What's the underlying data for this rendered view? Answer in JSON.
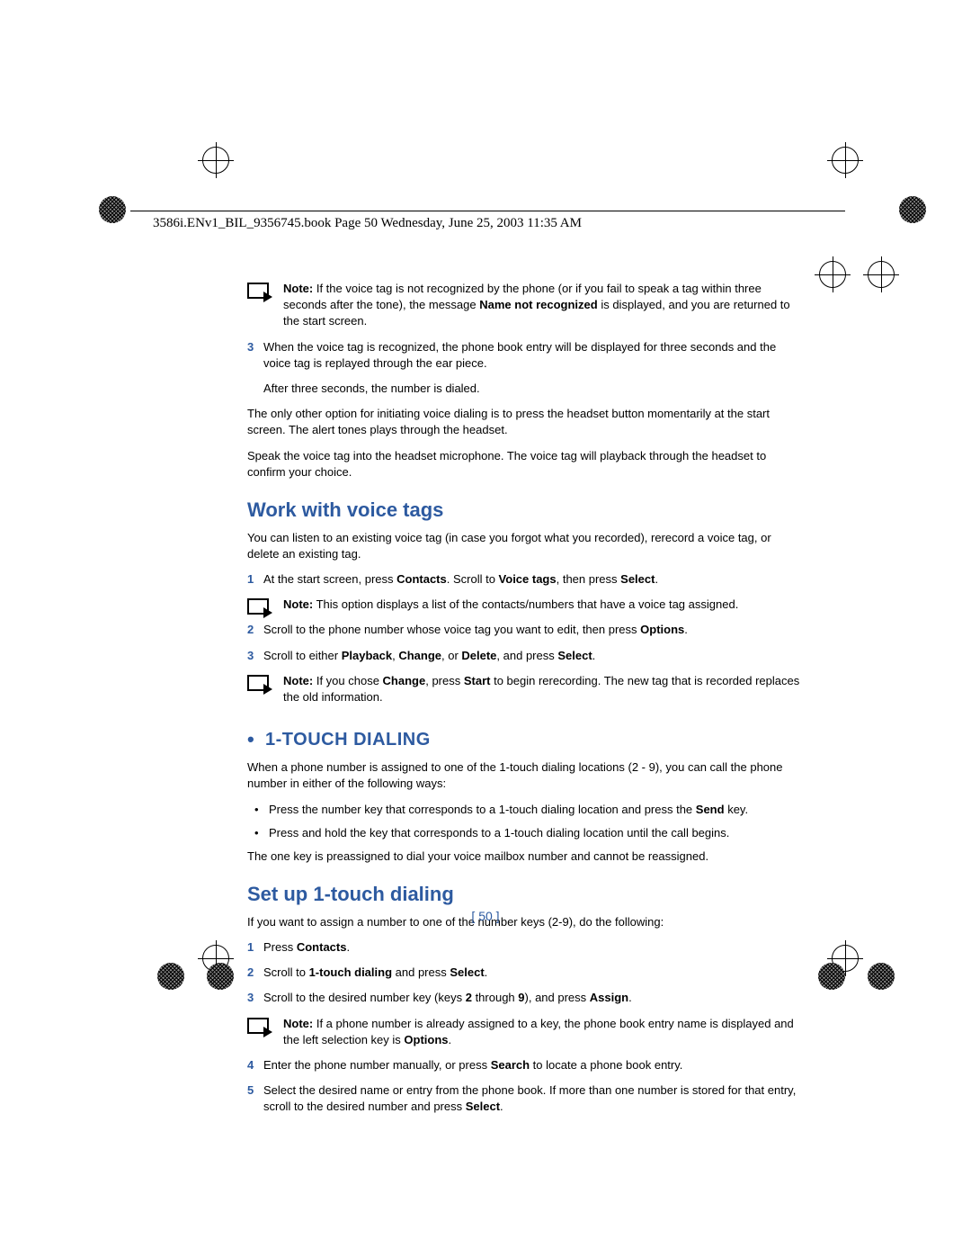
{
  "header": "3586i.ENv1_BIL_9356745.book  Page 50  Wednesday, June 25, 2003  11:35 AM",
  "note1_lead": "Note:",
  "note1_a": " If the voice tag is not recognized by the phone (or if you fail to speak a tag within three seconds after the tone), the message ",
  "note1_b": "Name not recognized",
  "note1_c": " is displayed, and you are returned to the start screen.",
  "step3_top": "When the voice tag is recognized, the phone book entry will be displayed for three seconds and the voice tag is replayed through the ear piece.",
  "step3_after": "After three seconds, the number is dialed.",
  "para_headset1": "The only other option for initiating voice dialing is to press the headset button momentarily at the start screen. The alert tones plays through the headset.",
  "para_headset2": "Speak the voice tag into the headset microphone. The voice tag will playback through the headset to confirm your choice.",
  "h_work": "Work with voice tags",
  "work_intro": "You can listen to an existing voice tag (in case you forgot what you recorded), rerecord a voice tag, or delete an existing tag.",
  "w1_a": "At the start screen, press ",
  "w1_contacts": "Contacts",
  "w1_b": ". Scroll to ",
  "w1_voice": "Voice tags",
  "w1_c": ", then press ",
  "w1_select": "Select",
  "w1_d": ".",
  "note2_lead": "Note:",
  "note2_body": " This option displays a list of the contacts/numbers that have a voice tag assigned.",
  "w2_a": "Scroll to the phone number whose voice tag you want to edit, then press ",
  "w2_opt": "Options",
  "w2_b": ".",
  "w3_a": "Scroll to either ",
  "w3_pb": "Playback",
  "w3_c1": ", ",
  "w3_ch": "Change",
  "w3_c2": ", or ",
  "w3_del": "Delete",
  "w3_c3": ", and press ",
  "w3_sel": "Select",
  "w3_c4": ".",
  "note3_lead": "Note:",
  "note3_a": " If you chose ",
  "note3_ch": "Change",
  "note3_b": ", press ",
  "note3_start": "Start",
  "note3_c": " to begin rerecording. The new tag that is recorded replaces the old information.",
  "h_touch": "1-TOUCH DIALING",
  "touch_intro": "When a phone number is assigned to one of the 1-touch dialing locations (2 - 9), you can call the phone number in either of the following ways:",
  "tb1_a": "Press the number key that corresponds to a 1-touch dialing location and press the ",
  "tb1_send": "Send",
  "tb1_b": " key.",
  "tb2": "Press and hold the key that corresponds to a 1-touch dialing location until the call begins.",
  "touch_one": "The one key is preassigned to dial your voice mailbox number and cannot be reassigned.",
  "h_setup": "Set up 1-touch dialing",
  "setup_intro": "If you want to assign a number to one of the number keys (2-9), do the following:",
  "s1_a": "Press ",
  "s1_contacts": "Contacts",
  "s1_b": ".",
  "s2_a": "Scroll to ",
  "s2_1t": "1-touch dialing",
  "s2_b": " and press ",
  "s2_sel": "Select",
  "s2_c": ".",
  "s3_a": "Scroll to the desired number key (keys ",
  "s3_2": "2",
  "s3_b": " through ",
  "s3_9": "9",
  "s3_c": "), and press ",
  "s3_asg": "Assign",
  "s3_d": ".",
  "note4_lead": "Note:",
  "note4_a": " If a phone number is already assigned to a key, the phone book entry name is displayed and the left selection key is ",
  "note4_opt": "Options",
  "note4_b": ".",
  "s4_a": "Enter the phone number manually, or press ",
  "s4_search": "Search",
  "s4_b": " to locate a phone book entry.",
  "s5_a": "Select the desired name or entry from the phone book. If more than one number is stored for that entry, scroll to the desired number and press ",
  "s5_sel": "Select",
  "s5_b": ".",
  "page_num": "[ 50 ]"
}
